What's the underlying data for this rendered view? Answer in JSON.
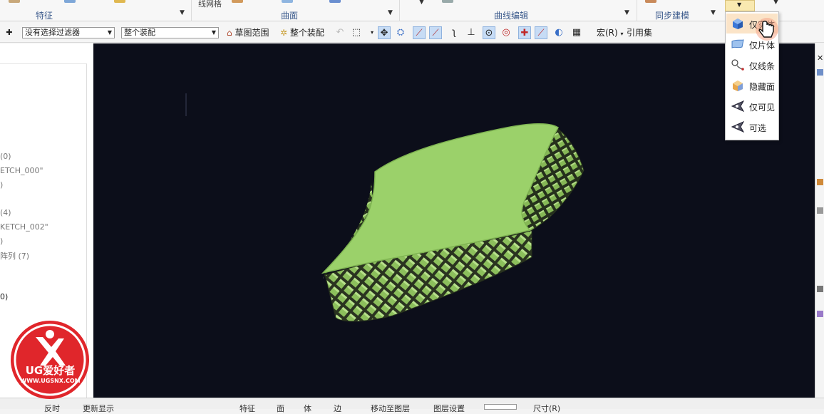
{
  "ribbon": {
    "groups": [
      {
        "label": "特征"
      },
      {
        "label": "曲面"
      },
      {
        "label": "曲线编辑"
      },
      {
        "label": "同步建模"
      }
    ],
    "cut_label": "线网格"
  },
  "toolbar": {
    "filter_combo": "没有选择过滤器",
    "scope_combo": "整个装配",
    "sketch_range": "草图范围",
    "whole_assembly": "整个装配",
    "macro": "宏(R)",
    "ref_set": "引用集"
  },
  "navigator": {
    "items": [
      {
        "text": "(0)"
      },
      {
        "text": "ETCH_000\""
      },
      {
        "text": ")"
      },
      {
        "text": "(4)"
      },
      {
        "text": "KETCH_002\""
      },
      {
        "text": ")"
      },
      {
        "text": "阵列 (7)"
      },
      {
        "text": "0)"
      }
    ]
  },
  "selection_menu": {
    "items": [
      {
        "label": "仅实体",
        "icon": "solid-body-icon",
        "highlighted": true
      },
      {
        "label": "仅片体",
        "icon": "sheet-body-icon",
        "highlighted": false
      },
      {
        "label": "仅线条",
        "icon": "curve-icon",
        "highlighted": false
      },
      {
        "label": "隐藏面",
        "icon": "hidden-face-icon",
        "highlighted": false
      },
      {
        "label": "仅可见",
        "icon": "visible-only-icon",
        "highlighted": false
      },
      {
        "label": "可选",
        "icon": "selectable-icon",
        "highlighted": false
      }
    ]
  },
  "statusbar": {
    "items": [
      "反时",
      "更新显示",
      "特征",
      "面",
      "体",
      "边",
      "移动至图层",
      "图层设置",
      "尺寸(R)"
    ]
  },
  "logo": {
    "brand": "UG爱好者",
    "url": "WWW.UGSNX.COM"
  },
  "colors": {
    "viewport_bg": "#0c0e1a",
    "model_green": "#9bd16a",
    "menu_highlight": "#fbe4c8",
    "logo_red": "#e0262b"
  }
}
